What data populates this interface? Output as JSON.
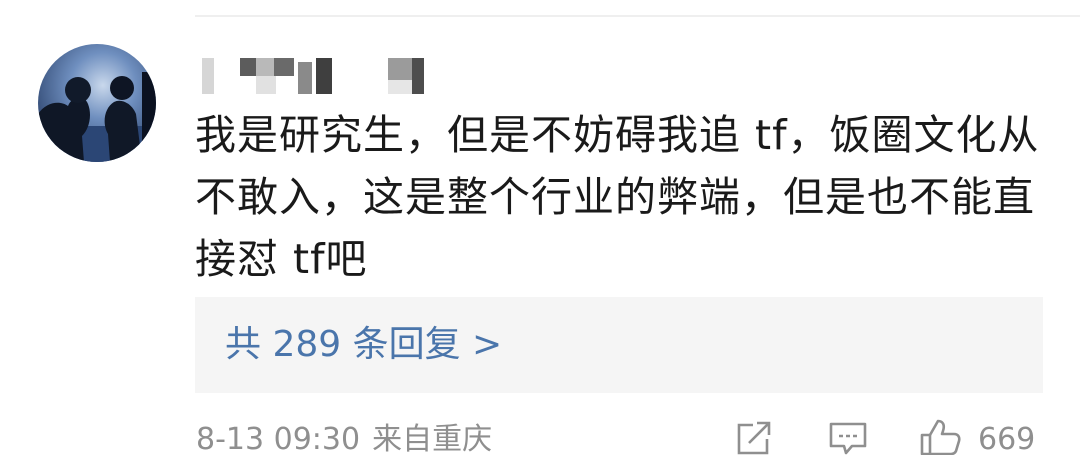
{
  "comment": {
    "username": "",
    "text": "我是研究生，但是不妨碍我追 tf，饭圈文化从不敢入，这是整个行业的弊端，但是也不能直接怼 tf吧",
    "replies_label": "共 289 条回复 >",
    "timestamp": "8-13 09:30",
    "location": "来自重庆",
    "like_count": "669"
  },
  "icons": {
    "share": "share-icon",
    "comment": "comment-icon",
    "like": "thumbs-up-icon"
  },
  "colors": {
    "reply_link": "#4a75ab",
    "meta_text": "#8f8f8f",
    "reply_box_bg": "#f5f5f5"
  }
}
